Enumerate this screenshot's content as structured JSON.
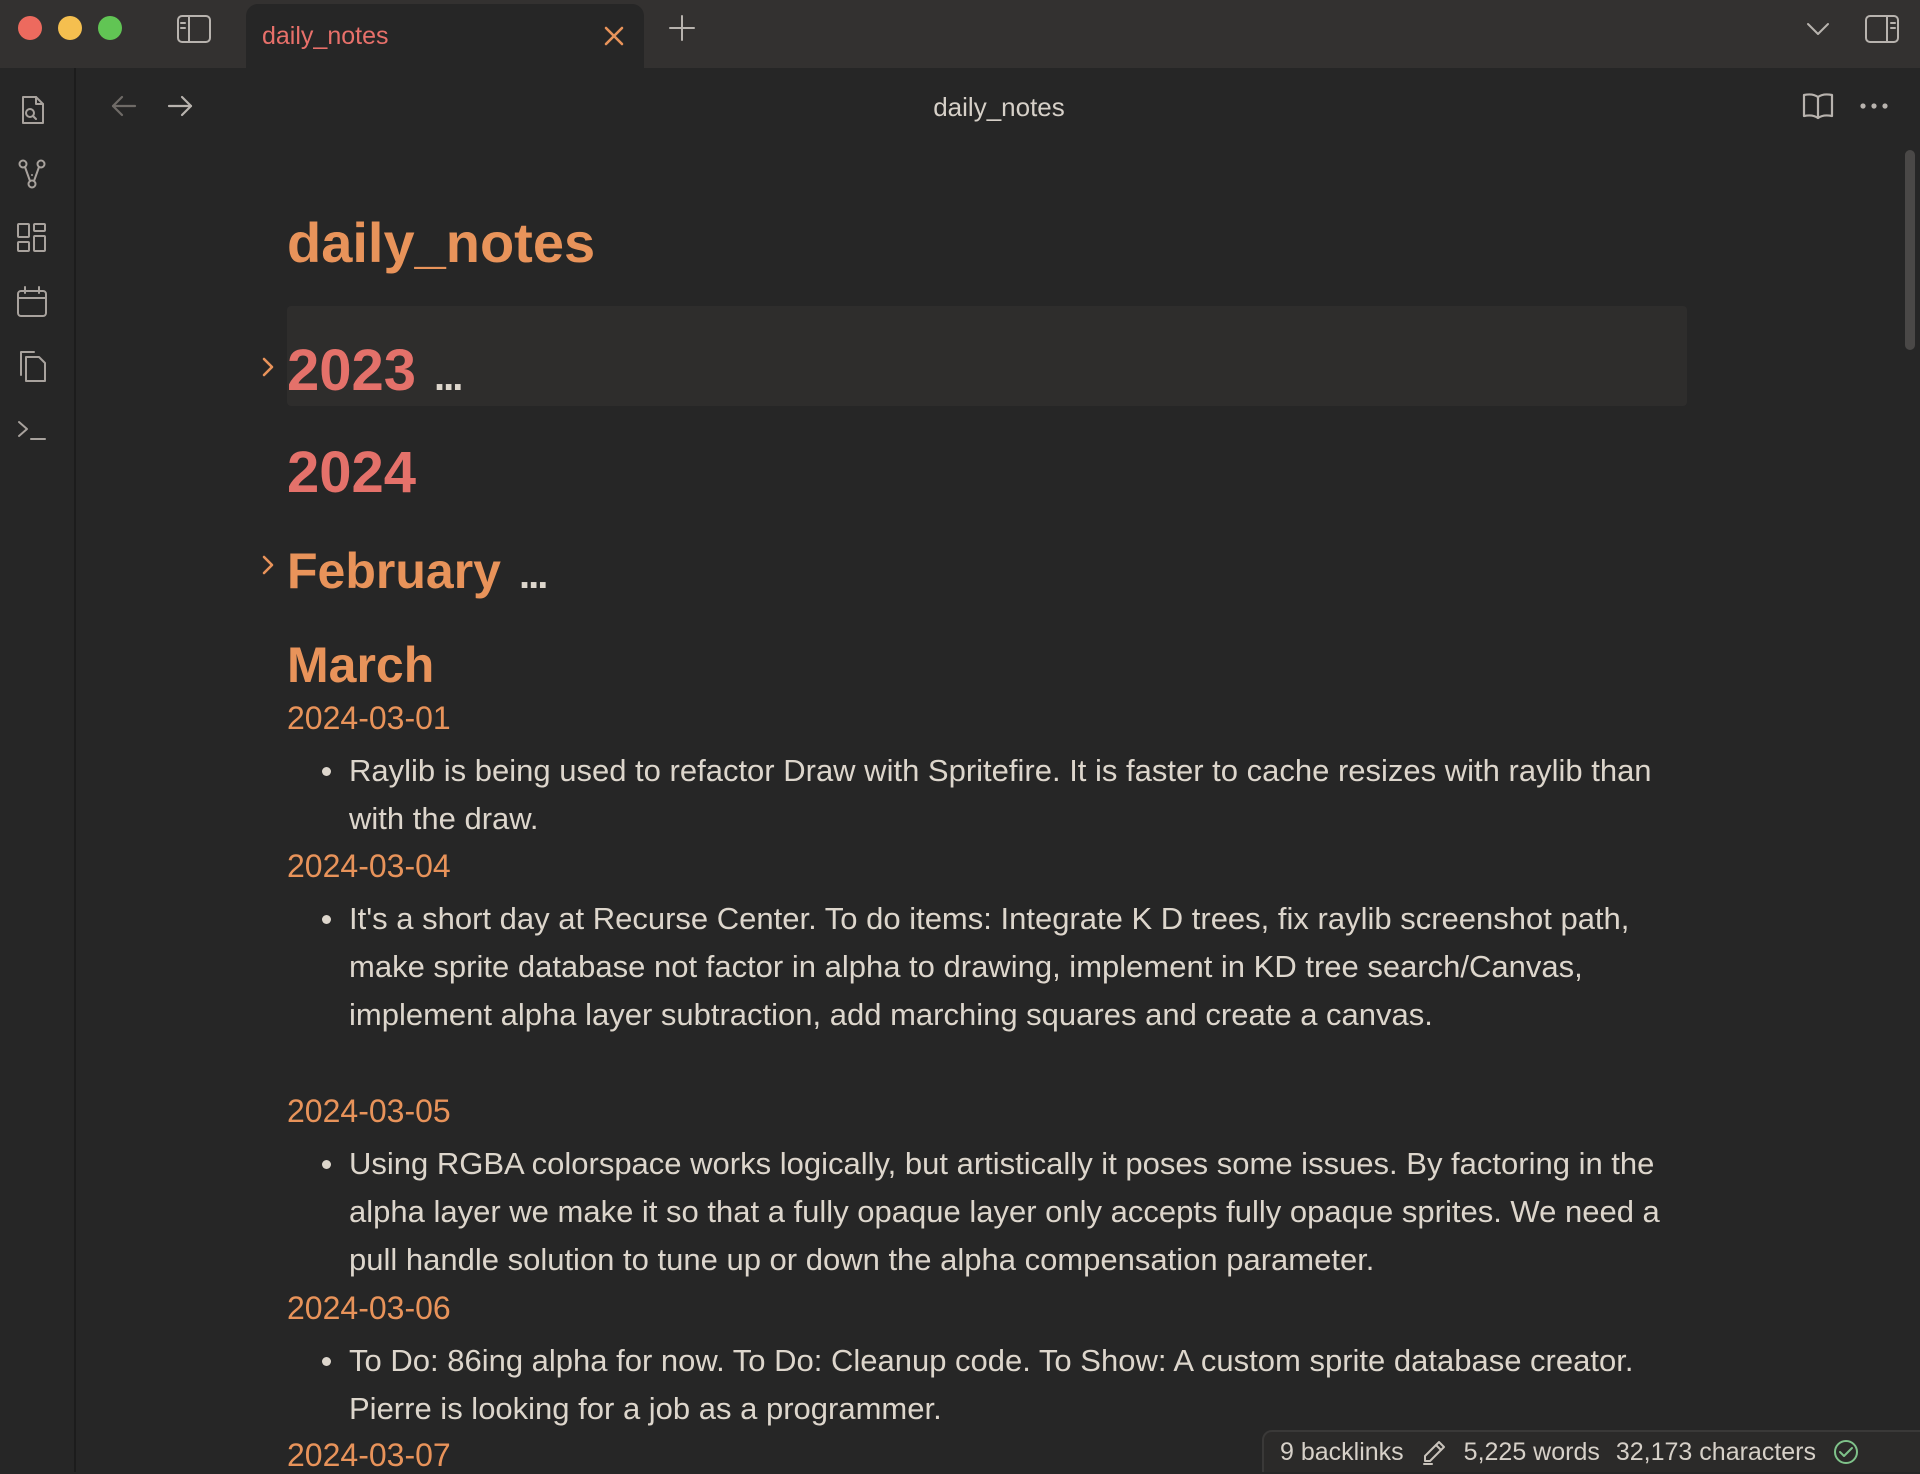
{
  "window": {
    "tab_title": "daily_notes"
  },
  "header": {
    "title": "daily_notes"
  },
  "note": {
    "title": "daily_notes",
    "sections": {
      "year_2023": "2023",
      "year_2024": "2024",
      "february": "February",
      "march": "March",
      "ellipsis": "..."
    },
    "entries": [
      {
        "date": "2024-03-01",
        "text": "Raylib is being used to refactor Draw with Spritefire. It is faster to cache resizes with raylib than with the draw."
      },
      {
        "date": "2024-03-04",
        "text": "It's a short day at Recurse Center. To do items: Integrate K D trees, fix raylib screenshot path, make sprite database not factor in alpha to drawing, implement in KD tree search/Canvas, implement alpha layer subtraction, add marching squares and create a canvas."
      },
      {
        "date": "2024-03-05",
        "text": "Using RGBA colorspace works logically, but artistically it poses some issues. By factoring in the alpha layer we make it so that a fully opaque layer only accepts fully opaque sprites. We need a pull handle solution to tune up or down the alpha compensation parameter."
      },
      {
        "date": "2024-03-06",
        "text": "To Do: 86ing alpha for now. To Do: Cleanup code. To Show: A custom sprite database creator. Pierre is looking for a job as a programmer."
      },
      {
        "date": "2024-03-07",
        "text": ""
      }
    ]
  },
  "status": {
    "backlinks": "9 backlinks",
    "words": "5,225 words",
    "characters": "32,173 characters"
  },
  "colors": {
    "accent_orange": "#e8935a",
    "accent_red": "#e4716a",
    "background": "#262626",
    "text": "#ddd6cc"
  }
}
